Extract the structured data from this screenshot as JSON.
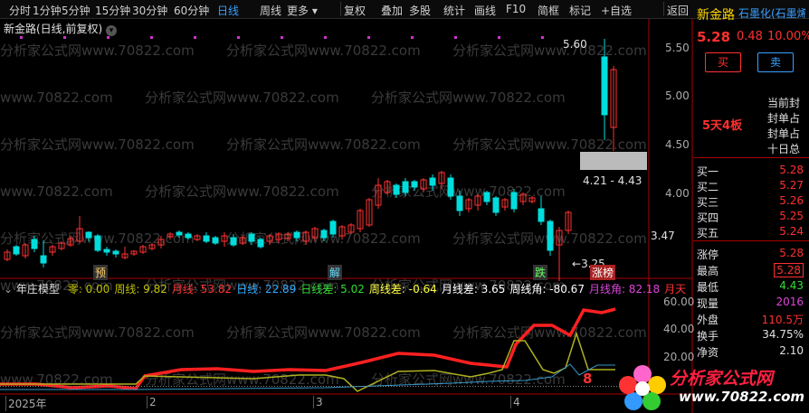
{
  "toolbar": {
    "items": [
      "分时",
      "1分钟",
      "5分钟",
      "15分钟",
      "30分钟",
      "60分钟",
      "日线",
      "周线",
      "更多 ▾",
      "复权",
      "叠加",
      "多股",
      "统计",
      "画线",
      "F10",
      "简框",
      "标记",
      "+自选",
      "返回"
    ],
    "active": "日线"
  },
  "chart_title": "新金路(日线,前复权)",
  "stock": {
    "name": "新金路",
    "tag": "石墨化(石墨烯",
    "price": "5.28",
    "change": "0.48",
    "change_pct": "10.00%",
    "buy_label": "买",
    "sell_label": "卖",
    "side_notes": [
      "当前封",
      "封单占",
      "封单占",
      "十日总"
    ],
    "streak": "5天4板"
  },
  "orderbook": [
    {
      "label": "买一",
      "value": "5.28"
    },
    {
      "label": "买二",
      "value": "5.27"
    },
    {
      "label": "买三",
      "value": "5.26"
    },
    {
      "label": "买四",
      "value": "5.25"
    },
    {
      "label": "买五",
      "value": "5.24"
    }
  ],
  "quote_rows": [
    {
      "label": "涨停",
      "value": "5.28"
    },
    {
      "label": "最高",
      "value": "5.28"
    },
    {
      "label": "最低",
      "value": "4.43"
    },
    {
      "label": "现量",
      "value": "2016"
    },
    {
      "label": "外盘",
      "value": "110.5万"
    },
    {
      "label": "换手",
      "value": "34.75%"
    },
    {
      "label": "净资",
      "value": "2.10"
    }
  ],
  "price_axis": [
    "5.50",
    "5.00",
    "4.50",
    "4.00",
    "3.47"
  ],
  "price_annotations": {
    "high": "5.60",
    "low": "3.25",
    "range": "4.21 - 4.43"
  },
  "signal_labels": [
    "预",
    "解",
    "跌",
    "涨榜"
  ],
  "indicator": {
    "name": "年庄模型",
    "fields": [
      {
        "label": "零: 0.00",
        "color": "#c0c000"
      },
      {
        "label": "周线: 9.82",
        "color": "#c0c000"
      },
      {
        "label": "月线: 53.82",
        "color": "#ff3333"
      },
      {
        "label": "日线: 22.89",
        "color": "#33aaff"
      },
      {
        "label": "日线差: 5.02",
        "color": "#33dd33"
      },
      {
        "label": "周线差: -0.64",
        "color": "#ffff44"
      },
      {
        "label": "月线差: 3.65",
        "color": "#ffffff"
      },
      {
        "label": "周线角: -80.67",
        "color": "#ffffff"
      },
      {
        "label": "月线角: 82.18",
        "color": "#dd44dd"
      },
      {
        "label": "月天",
        "color": "#ff3333"
      }
    ],
    "axis": [
      "60.00",
      "40.00",
      "20.00"
    ],
    "marker": "8"
  },
  "date_axis": [
    "2025年",
    "2",
    "3",
    "4"
  ],
  "watermark": "分析家公式网www.70822.com",
  "logo": {
    "title": "分析家公式网",
    "url": "www.70822.com"
  },
  "colors": {
    "up": "#ff3232",
    "down": "#00dddd",
    "accent": "#3aa0ff",
    "bg": "#000000"
  }
}
